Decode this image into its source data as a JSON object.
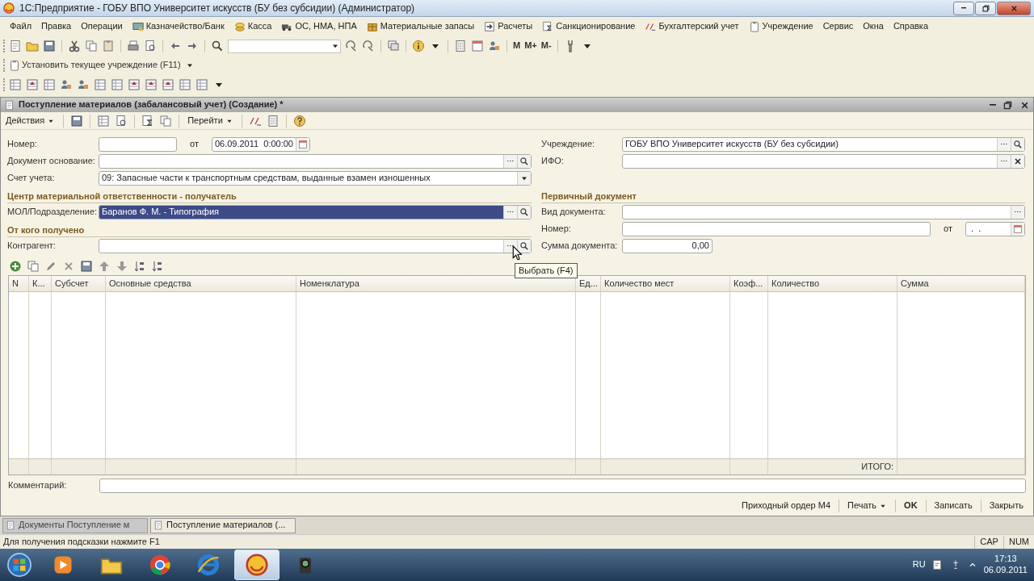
{
  "window": {
    "title": "1С:Предприятие - ГОБУ ВПО Университет искусств (БУ без субсидии) (Администратор)"
  },
  "menu": [
    {
      "label": "Файл",
      "kind": "plain"
    },
    {
      "label": "Правка",
      "kind": "plain"
    },
    {
      "label": "Операции",
      "kind": "plain"
    },
    {
      "label": "Казначейство/Банк",
      "kind": "icon"
    },
    {
      "label": "Касса",
      "kind": "icon"
    },
    {
      "label": "ОС, НМА, НПА",
      "kind": "icon"
    },
    {
      "label": "Материальные запасы",
      "kind": "icon"
    },
    {
      "label": "Расчеты",
      "kind": "icon"
    },
    {
      "label": "Санкционирование",
      "kind": "icon"
    },
    {
      "label": "Бухгалтерский учет",
      "kind": "icon"
    },
    {
      "label": "Учреждение",
      "kind": "icon"
    },
    {
      "label": "Сервис",
      "kind": "plain"
    },
    {
      "label": "Окна",
      "kind": "plain"
    },
    {
      "label": "Справка",
      "kind": "plain"
    }
  ],
  "toolbar": {
    "memory_buttons": [
      "M",
      "M+",
      "M-"
    ]
  },
  "institution_button": "Установить текущее учреждение (F11)",
  "document": {
    "title": "Поступление материалов (забалансовый учет) (Создание) *",
    "actions": [
      {
        "label": "Действия"
      },
      {
        "label": "Перейти"
      }
    ],
    "left": [
      {
        "kind": "number",
        "label": "Номер:",
        "date_label": "от",
        "date_value": "06.09.2011  0:00:00"
      },
      {
        "kind": "ref",
        "label": "Документ основание:",
        "selected": false
      },
      {
        "kind": "select",
        "label": "Счет учета:",
        "value": "09: Запасные части к транспортным средствам, выданные взамен изношенных"
      },
      {
        "kind": "heading",
        "text": "Центр материальной ответственности - получатель"
      },
      {
        "kind": "ref",
        "label": "МОЛ/Подразделение:",
        "value": "Баранов Ф. М. - Типография",
        "selected": true
      },
      {
        "kind": "heading",
        "text": "От кого получено"
      },
      {
        "kind": "ref",
        "label": "Контрагент:",
        "selected": false,
        "tooltip": "Выбрать (F4)"
      }
    ],
    "right": [
      {
        "kind": "ref",
        "label": "Учреждение:",
        "value": "ГОБУ ВПО Университет искусств (БУ без субсидии)",
        "selected": false
      },
      {
        "kind": "clearable",
        "label": "ИФО:"
      },
      {
        "kind": "heading",
        "text": "Первичный документ"
      },
      {
        "kind": "dots",
        "label": "Вид документа:"
      },
      {
        "kind": "numdate",
        "label": "Номер:",
        "date_label": "от",
        "date_value": " .  ."
      },
      {
        "kind": "amount",
        "label": "Сумма документа:",
        "value": "0,00"
      }
    ],
    "table": {
      "columns": [
        "N",
        "К...",
        "Субсчет",
        "Основные средства",
        "Номенклатура",
        "Ед...",
        "Количество мест",
        "Коэф...",
        "Количество",
        "Сумма"
      ],
      "total_label": "ИТОГО:"
    },
    "comment": {
      "label": "Комментарий:"
    },
    "buttons": [
      {
        "label": "Приходный ордер М4",
        "kind": "plain"
      },
      {
        "label": "Печать",
        "kind": "menu"
      },
      {
        "label": "OK",
        "kind": "default"
      },
      {
        "label": "Записать",
        "kind": "plain"
      },
      {
        "label": "Закрыть",
        "kind": "plain"
      }
    ]
  },
  "window_tabs": [
    {
      "label": "Документы Поступление м",
      "selected": false
    },
    {
      "label": "Поступление материалов (...",
      "selected": true
    }
  ],
  "status_bar": {
    "hint": "Для получения подсказки нажмите F1",
    "indicators": [
      "CAP",
      "NUM"
    ]
  },
  "taskbar": {
    "apps": [
      {
        "selected": false
      },
      {
        "selected": false
      },
      {
        "selected": false
      },
      {
        "selected": false
      },
      {
        "selected": true
      },
      {
        "selected": false
      }
    ],
    "language": "RU",
    "time": "17:13",
    "date": "06.09.2011"
  }
}
